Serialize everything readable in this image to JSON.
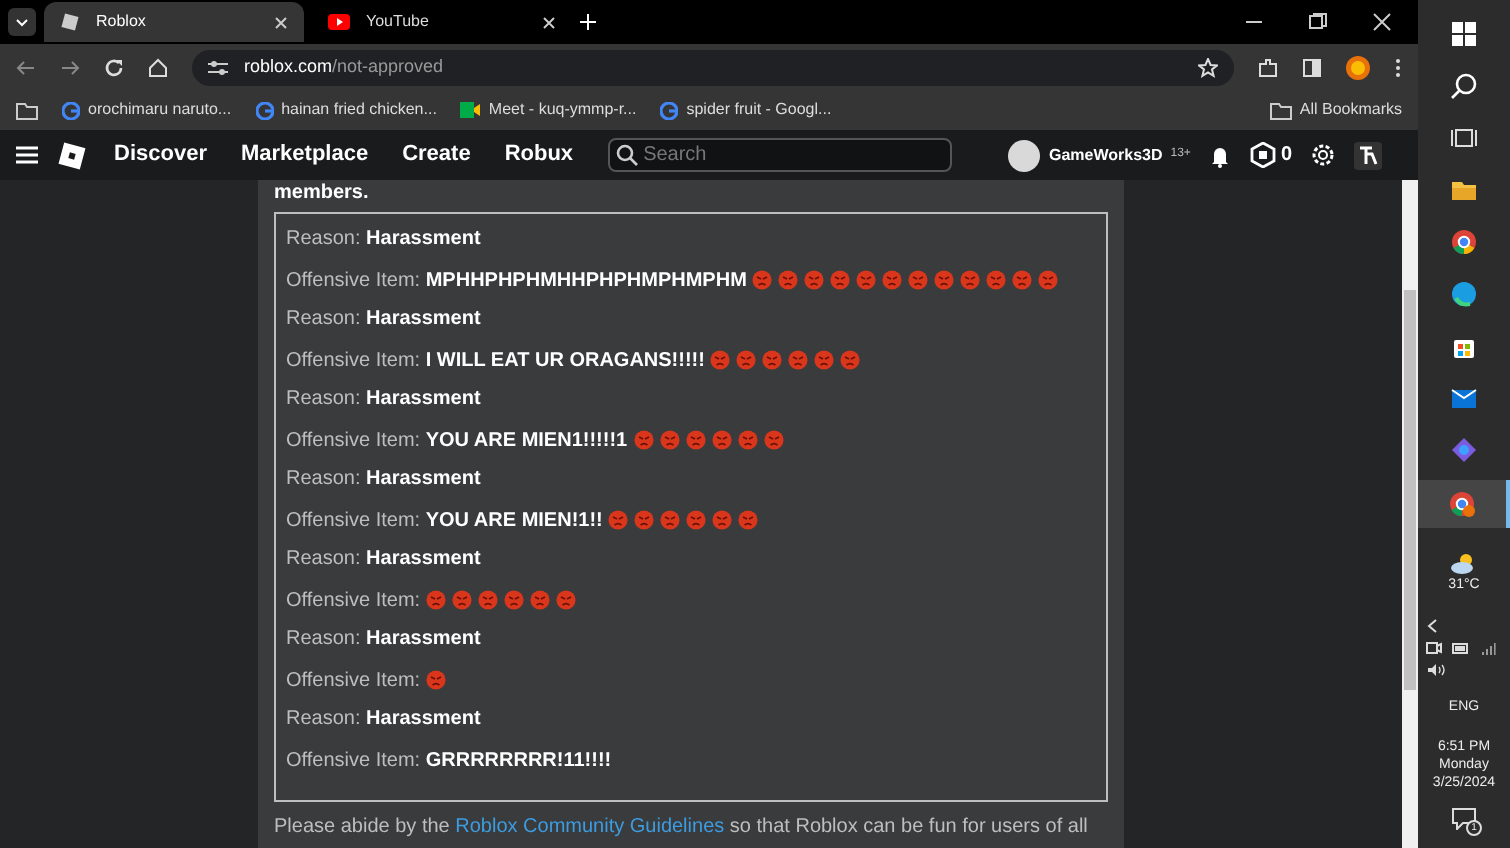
{
  "browser": {
    "tabs": [
      {
        "title": "Roblox",
        "selected": true,
        "kind": "roblox"
      },
      {
        "title": "YouTube",
        "selected": false,
        "kind": "youtube"
      }
    ],
    "url": {
      "host": "roblox.com",
      "path": "/not-approved"
    },
    "bookmarks": [
      {
        "label": "orochimaru naruto...",
        "kind": "google"
      },
      {
        "label": "hainan fried chicken...",
        "kind": "google"
      },
      {
        "label": "Meet - kuq-ymmp-r...",
        "kind": "meet"
      },
      {
        "label": "spider fruit - Googl...",
        "kind": "google"
      }
    ],
    "all_bookmarks": "All Bookmarks"
  },
  "nav": {
    "links": [
      "Discover",
      "Marketplace",
      "Create",
      "Robux"
    ],
    "search": {
      "placeholder": "Search"
    },
    "username": "GameWorks3D",
    "age_badge": "13+",
    "robux": "0"
  },
  "page": {
    "intro_tail": "members.",
    "entries": [
      {
        "reason_label": "Reason:",
        "reason": "Harassment",
        "item_label": "Offensive Item:",
        "item": "MPHHPHPHMHHPHPHMPHMPHM",
        "emojis": [
          {
            "kind": "angry-face"
          },
          {
            "kind": "angry-face"
          },
          {
            "kind": "angry-face"
          },
          {
            "kind": "angry-face"
          },
          {
            "kind": "angry-face"
          },
          {
            "kind": "angry-face"
          },
          {
            "kind": "angry-face"
          },
          {
            "kind": "angry-face"
          },
          {
            "kind": "angry-face"
          },
          {
            "kind": "angry-face"
          },
          {
            "kind": "angry-face"
          },
          {
            "kind": "angry-face"
          }
        ]
      },
      {
        "reason_label": "Reason:",
        "reason": "Harassment",
        "item_label": "Offensive Item:",
        "item": "I WILL EAT UR ORAGANS!!!!!",
        "emojis": [
          {
            "kind": "angry-face"
          },
          {
            "kind": "angry-face"
          },
          {
            "kind": "angry-face"
          },
          {
            "kind": "angry-face"
          },
          {
            "kind": "angry-face"
          },
          {
            "kind": "angry-face"
          }
        ]
      },
      {
        "reason_label": "Reason:",
        "reason": "Harassment",
        "item_label": "Offensive Item:",
        "item": "YOU ARE MIEN1!!!!!1",
        "emojis": [
          {
            "kind": "angry-face"
          },
          {
            "kind": "angry-face"
          },
          {
            "kind": "angry-face"
          },
          {
            "kind": "angry-face"
          },
          {
            "kind": "angry-face"
          },
          {
            "kind": "angry-face"
          }
        ]
      },
      {
        "reason_label": "Reason:",
        "reason": "Harassment",
        "item_label": "Offensive Item:",
        "item": "YOU ARE MIEN!1!!",
        "emojis": [
          {
            "kind": "angry-face"
          },
          {
            "kind": "angry-face"
          },
          {
            "kind": "angry-face"
          },
          {
            "kind": "angry-face"
          },
          {
            "kind": "angry-face"
          },
          {
            "kind": "angry-face"
          }
        ]
      },
      {
        "reason_label": "Reason:",
        "reason": "Harassment",
        "item_label": "Offensive Item:",
        "emojis": [
          {
            "kind": "angry-face"
          },
          {
            "kind": "angry-face"
          },
          {
            "kind": "angry-face"
          },
          {
            "kind": "angry-face"
          },
          {
            "kind": "angry-face"
          },
          {
            "kind": "angry-face"
          }
        ]
      },
      {
        "reason_label": "Reason:",
        "reason": "Harassment",
        "item_label": "Offensive Item:",
        "emojis": [
          {
            "kind": "angry-face"
          }
        ]
      },
      {
        "reason_label": "Reason:",
        "reason": "Harassment",
        "item_label": "Offensive Item:",
        "item": "GRRRRRRRR!11!!!!"
      }
    ],
    "footer_before": "Please abide by the",
    "footer_link": "Roblox Community Guidelines",
    "footer_after": "so that Roblox can be fun for users of all"
  },
  "taskbar": {
    "weather": "31°C",
    "language": "ENG",
    "time": "6:51 PM",
    "day": "Monday",
    "date": "3/25/2024",
    "notifications": "1"
  }
}
